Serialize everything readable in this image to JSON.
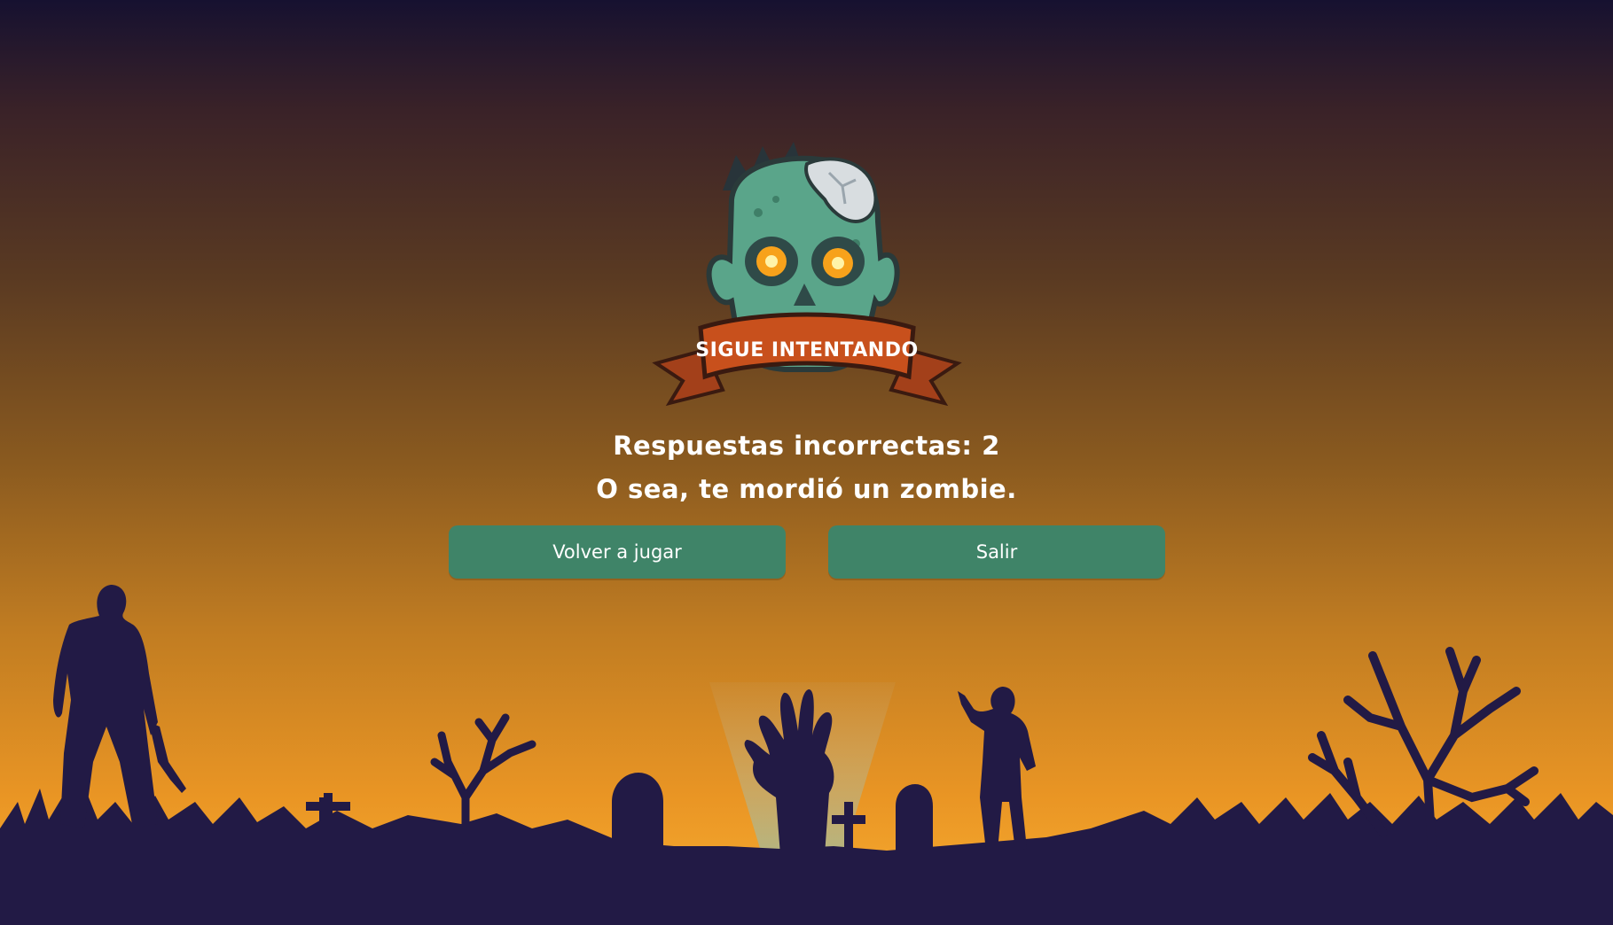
{
  "banner": {
    "text": "SIGUE INTENTANDO"
  },
  "result": {
    "score_text": "Respuestas incorrectas: 2",
    "message": "O sea, te mordió un zombie."
  },
  "buttons": {
    "replay_label": "Volver a jugar",
    "exit_label": "Salir"
  },
  "colors": {
    "sky_top": "#161130",
    "sky_bottom": "#f0a02a",
    "silhouette": "#221a45",
    "button": "#3f8468",
    "banner": "#c8501c",
    "zombie_skin": "#5aa58a",
    "eyes": "#f7a21b"
  }
}
